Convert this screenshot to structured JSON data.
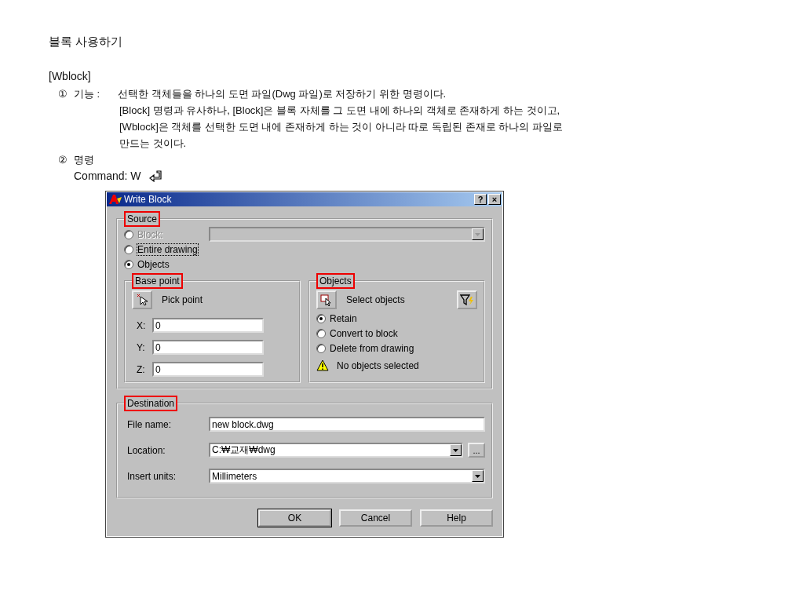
{
  "title": "블록 사용하기",
  "section": "[Wblock]",
  "function_item": {
    "marker": "①",
    "label": "기능 :",
    "lines": [
      "선택한 객체들을 하나의 도면 파일(Dwg 파일)로 저장하기 위한 명령이다.",
      "[Block] 명령과 유사하나, [Block]은 블록 자체를 그 도면 내에 하나의 객체로 존재하게 하는 것이고,",
      "[Wblock]은 객체를 선택한 도면 내에 존재하게 하는 것이 아니라 따로 독립된 존재로 하나의 파일로",
      "만드는 것이다."
    ]
  },
  "command_item": {
    "marker": "②",
    "label": "명령"
  },
  "command": "Command: W",
  "dialog": {
    "title": "Write Block",
    "title_buttons": [
      "?",
      "×"
    ],
    "source": {
      "label": "Source",
      "highlighted": true,
      "options": [
        {
          "label": "Block:",
          "selected": false,
          "disabled": true,
          "focused": false
        },
        {
          "label": "Entire drawing",
          "selected": false,
          "disabled": false,
          "focused": true
        },
        {
          "label": "Objects",
          "selected": true,
          "disabled": false,
          "focused": false
        }
      ]
    },
    "base_point": {
      "label": "Base point",
      "highlighted": true,
      "button": "Pick point",
      "coords": [
        {
          "axis": "X:",
          "value": "0"
        },
        {
          "axis": "Y:",
          "value": "0"
        },
        {
          "axis": "Z:",
          "value": "0"
        }
      ]
    },
    "objects": {
      "label": "Objects",
      "highlighted": true,
      "button": "Select objects",
      "options": [
        {
          "label": "Retain",
          "selected": true
        },
        {
          "label": "Convert to block",
          "selected": false
        },
        {
          "label": "Delete from drawing",
          "selected": false
        }
      ],
      "warning": "No objects selected"
    },
    "destination": {
      "label": "Destination",
      "highlighted": true,
      "fields": [
        {
          "kind": "text",
          "label": "File name:",
          "value": "new block.dwg"
        },
        {
          "kind": "browse",
          "label": "Location:",
          "value": "C:₩교재₩dwg",
          "browse": "..."
        },
        {
          "kind": "dropdown",
          "label": "Insert units:",
          "value": "Millimeters"
        }
      ]
    },
    "buttons": [
      {
        "label": "OK",
        "default": true
      },
      {
        "label": "Cancel",
        "default": false
      },
      {
        "label": "Help",
        "default": false
      }
    ]
  }
}
